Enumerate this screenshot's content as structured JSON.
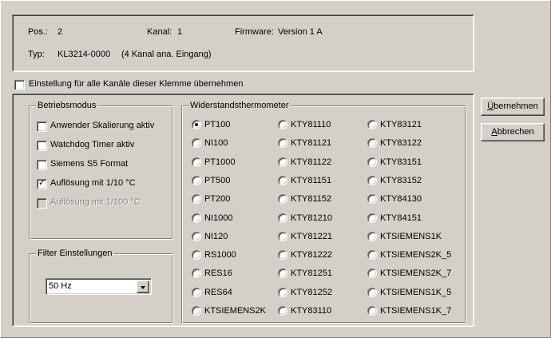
{
  "info": {
    "pos_label": "Pos.:",
    "pos_value": "2",
    "kanal_label": "Kanal:",
    "kanal_value": "1",
    "firmware_label": "Firmware:",
    "firmware_value": "Version 1 A",
    "typ_label": "Typ:",
    "typ_value": "KL3214-0000",
    "typ_desc": "(4 Kanal ana. Eingang)"
  },
  "apply_all": {
    "label": "Einstellung für alle Kanäle dieser Klemme übernehmen",
    "checked": false
  },
  "betriebsmodus": {
    "title": "Betriebsmodus",
    "options": [
      {
        "label": "Anwender Skalierung aktiv",
        "checked": false,
        "enabled": true
      },
      {
        "label": "Watchdog Timer aktiv",
        "checked": false,
        "enabled": true
      },
      {
        "label": "Siemens S5 Format",
        "checked": false,
        "enabled": true
      },
      {
        "label": "Auflösung mit 1/10 °C",
        "checked": true,
        "enabled": true
      },
      {
        "label": "Auflösung mit 1/100 °C",
        "checked": false,
        "enabled": false
      }
    ]
  },
  "filter": {
    "title": "Filter Einstellungen",
    "selected": "50 Hz"
  },
  "widerstand": {
    "title": "Widerstandsthermometer",
    "selected": "PT100",
    "columns": [
      [
        "PT100",
        "NI100",
        "PT1000",
        "PT500",
        "PT200",
        "NI1000",
        "NI120",
        "RS1000",
        "RES16",
        "RES64",
        "KTSIEMENS2K"
      ],
      [
        "KTY81110",
        "KTY81121",
        "KTY81122",
        "KTY81151",
        "KTY81152",
        "KTY81210",
        "KTY81221",
        "KTY81222",
        "KTY81251",
        "KTY81252",
        "KTY83110"
      ],
      [
        "KTY83121",
        "KTY83122",
        "KTY83151",
        "KTY83152",
        "KTY84130",
        "KTY84151",
        "KTSIEMENS1K",
        "KTSIEMENS2K_5",
        "KTSIEMENS2K_7",
        "KTSIEMENS1K_5",
        "KTSIEMENS1K_7"
      ]
    ]
  },
  "buttons": {
    "apply_first": "Ü",
    "apply_rest": "bernehmen",
    "cancel_first": "A",
    "cancel_rest": "bbrechen"
  }
}
